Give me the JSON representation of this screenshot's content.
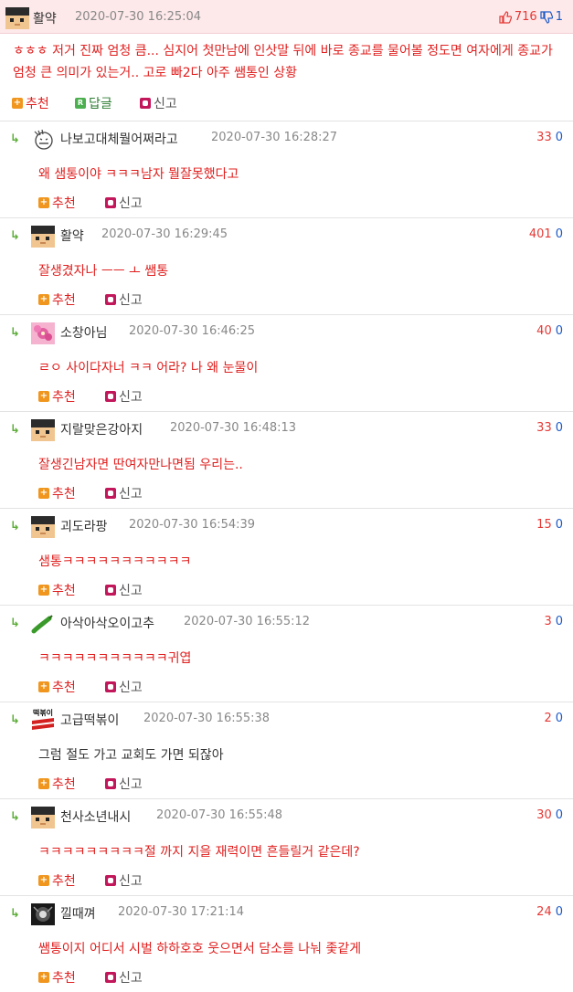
{
  "post": {
    "author": "활약",
    "timestamp": "2020-07-30 16:25:04",
    "upvotes": "716",
    "downvotes": "1",
    "text": "ㅎㅎㅎ 저거 진짜 엄청 큼... 심지어 첫만남에 인삿말 뒤에 바로 종교를 물어볼 정도면 여자에게 종교가 엄청 큰 의미가 있는거.. 고로 빠2다 아주 쌤통인 상황",
    "recommend_label": "추천",
    "reply_label": "답글",
    "report_label": "신고"
  },
  "actions": {
    "recommend": "추천",
    "report": "신고"
  },
  "comments": [
    {
      "author": "나보고대체뭘어쩌라고",
      "timestamp": "2020-07-30 16:28:27",
      "up": "33",
      "down": "0",
      "text": "왜 샘통이야 ㅋㅋㅋ남자 뭘잘못했다고",
      "avatar": "face-icon"
    },
    {
      "author": "활약",
      "timestamp": "2020-07-30 16:29:45",
      "up": "401",
      "down": "0",
      "text": "잘생겼자나 ㅡㅡ ㅗ 쌤통",
      "avatar": "pixel-avatar-icon"
    },
    {
      "author": "소창아님",
      "timestamp": "2020-07-30 16:46:25",
      "up": "40",
      "down": "0",
      "text": "ㄹㅇ 사이다자너 ㅋㅋ 어라? 나 왜 눈물이",
      "avatar": "flower-icon"
    },
    {
      "author": "지랄맞은강아지",
      "timestamp": "2020-07-30 16:48:13",
      "up": "33",
      "down": "0",
      "text": "잘생긴남자면 딴여자만나면됨 우리는..",
      "avatar": "pixel-avatar-icon"
    },
    {
      "author": "괴도라팡",
      "timestamp": "2020-07-30 16:54:39",
      "up": "15",
      "down": "0",
      "text": "샘통ㅋㅋㅋㅋㅋㅋㅋㅋㅋㅋㅋ",
      "avatar": "pixel-avatar-icon"
    },
    {
      "author": "아삭아삭오이고추",
      "timestamp": "2020-07-30 16:55:12",
      "up": "3",
      "down": "0",
      "text": "ㅋㅋㅋㅋㅋㅋㅋㅋㅋㅋㅋ귀엽",
      "avatar": "pepper-icon"
    },
    {
      "author": "고급떡볶이",
      "timestamp": "2020-07-30 16:55:38",
      "up": "2",
      "down": "0",
      "text": "그럼 절도 가고 교회도 가면 되잖아",
      "avatar": "tteokbokki-logo-icon",
      "avatar_text": "떡볶이"
    },
    {
      "author": "천사소년내시",
      "timestamp": "2020-07-30 16:55:48",
      "up": "30",
      "down": "0",
      "text": "ㅋㅋㅋㅋㅋㅋㅋㅋㅋ절 까지 지을 재력이면 흔들릴거 같은데?",
      "avatar": "pixel-avatar-icon"
    },
    {
      "author": "낄때껴",
      "timestamp": "2020-07-30 17:21:14",
      "up": "24",
      "down": "0",
      "text": "쌤통이지 어디서 시벌 하하호호 웃으면서 담소를 나눠 좇같게",
      "avatar": "dark-emblem-icon"
    }
  ]
}
